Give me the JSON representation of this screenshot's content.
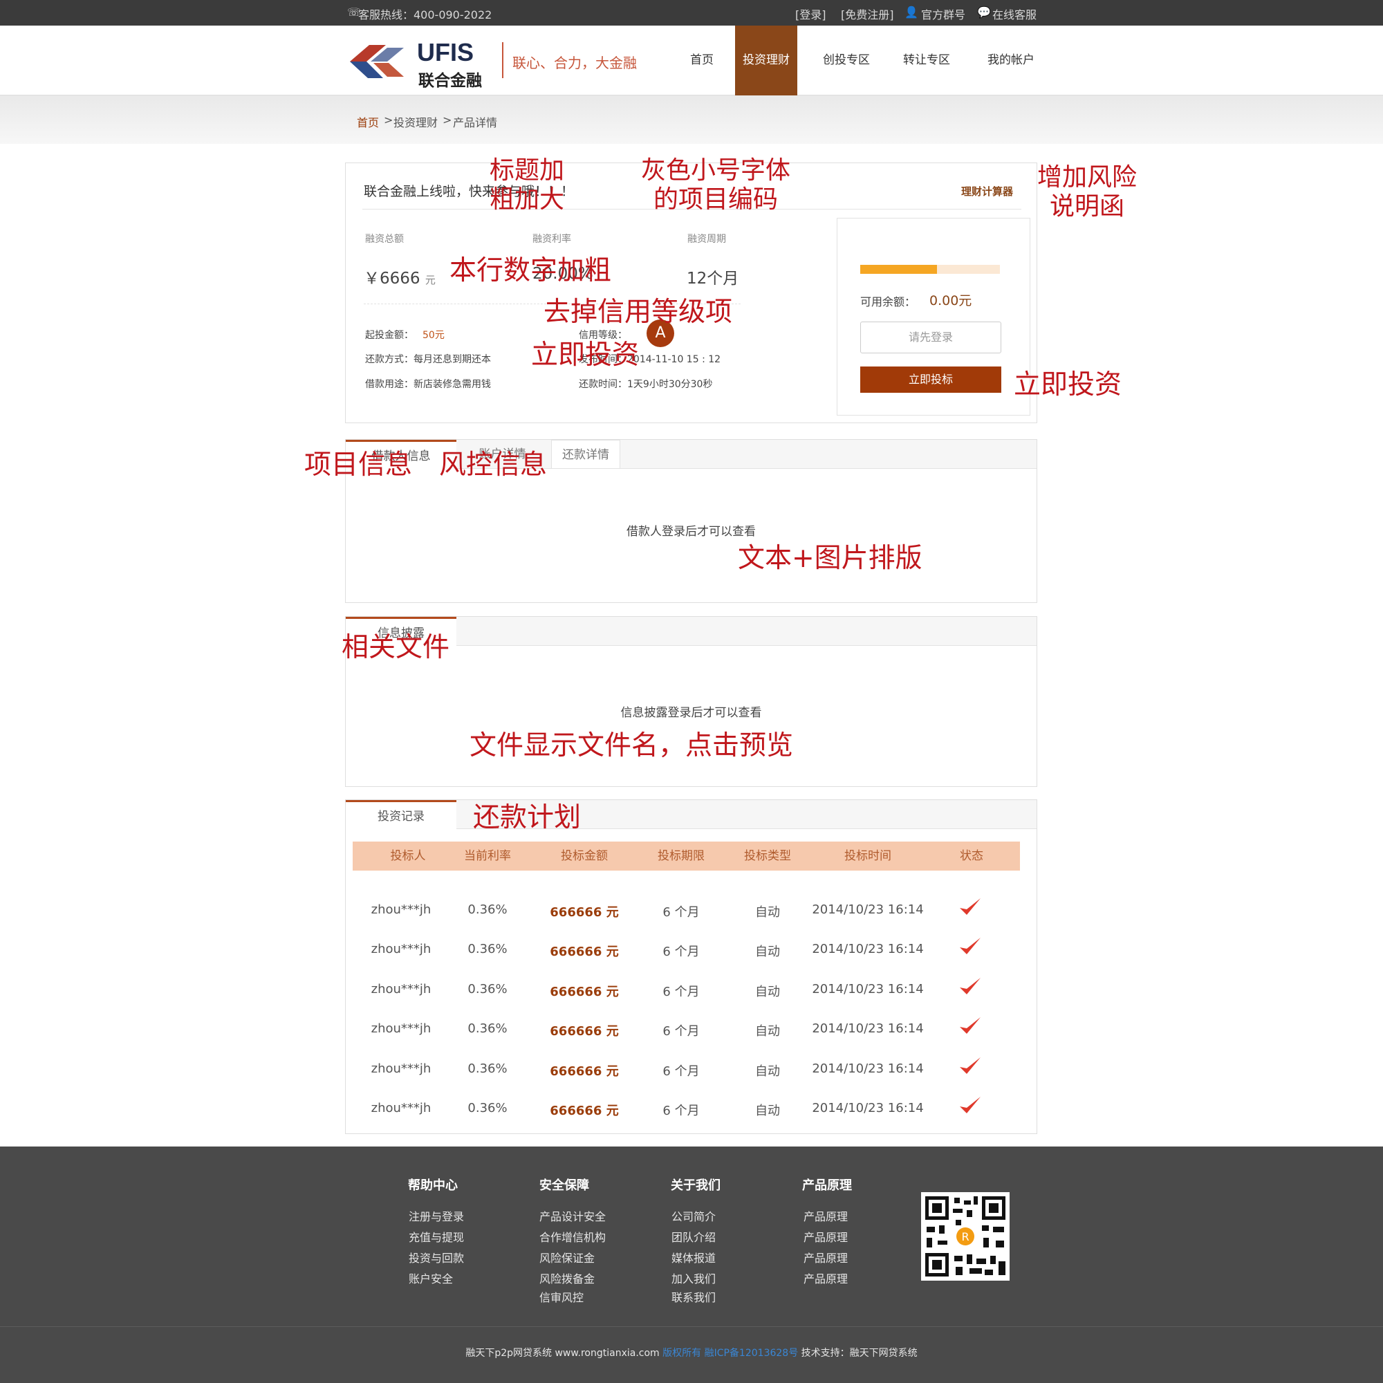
{
  "topbar": {
    "hotline": "客服热线：400-090-2022",
    "login": "[登录]",
    "register": "[免费注册]",
    "group": "官方群号",
    "service": "在线客服"
  },
  "brand": {
    "logo_en": "UFIS",
    "logo_cn": "联合金融",
    "slogan": "联心、合力，大金融"
  },
  "nav": [
    "首页",
    "投资理财",
    "创投专区",
    "转让专区",
    "我的帐户"
  ],
  "breadcrumb": {
    "home": "首页",
    "sep1": ">",
    "level2": "投资理财",
    "sep2": ">",
    "current": "产品详情"
  },
  "product": {
    "title": "联合金融上线啦，快来参与哦！！！",
    "calculator": "理财计算器",
    "total_label": "融资总额",
    "total_currency": "￥",
    "total_value": "6666",
    "total_unit": "元",
    "rate_label": "融资利率",
    "rate_value": "20.00%",
    "period_label": "融资周期",
    "period_value": "12个月",
    "min_label": "起投金额：",
    "min_value": "50元",
    "credit_label": "信用等级：",
    "credit_grade": "A",
    "repay_label": "还款方式：每月还息到期还本",
    "publish_label": "发布时间：2014-11-10 15 : 12",
    "usage_label": "借款用途：新店装修急需用钱",
    "remain_label": "还款时间：1天9小时30分30秒"
  },
  "invest_box": {
    "progress": 0.55,
    "balance_label": "可用余额：",
    "balance_value": "0.00元",
    "login_button": "请先登录",
    "invest_button": "立即投标"
  },
  "tabs1": [
    "借款人信息",
    "账户详情",
    "还款详情"
  ],
  "tabs1_message": "借款人登录后才可以查看",
  "tabs2": [
    "信息披露"
  ],
  "tabs2_message": "信息披露登录后才可以查看",
  "tabs3": [
    "投资记录"
  ],
  "records": {
    "headers": [
      "投标人",
      "当前利率",
      "投标金额",
      "投标期限",
      "投标类型",
      "投标时间",
      "状态"
    ],
    "rows": [
      [
        "zhou***jh",
        "0.36%",
        "666666 元",
        "6 个月",
        "自动",
        "2014/10/23  16:14"
      ],
      [
        "zhou***jh",
        "0.36%",
        "666666 元",
        "6 个月",
        "自动",
        "2014/10/23  16:14"
      ],
      [
        "zhou***jh",
        "0.36%",
        "666666 元",
        "6 个月",
        "自动",
        "2014/10/23  16:14"
      ],
      [
        "zhou***jh",
        "0.36%",
        "666666 元",
        "6 个月",
        "自动",
        "2014/10/23  16:14"
      ],
      [
        "zhou***jh",
        "0.36%",
        "666666 元",
        "6 个月",
        "自动",
        "2014/10/23  16:14"
      ],
      [
        "zhou***jh",
        "0.36%",
        "666666 元",
        "6 个月",
        "自动",
        "2014/10/23  16:14"
      ]
    ]
  },
  "annotations": {
    "title_bold": "标题加\n粗加大",
    "code_gray": "灰色小号字体\n的项目编码",
    "risk_letter": "增加风险\n说明函",
    "bold_numbers": "本行数字加粗",
    "remove_credit": "去掉信用等级项",
    "invest_now_mid": "立即投资",
    "invest_now_right": "立即投资",
    "project_info": "项目信息",
    "risk_info": "风控信息",
    "text_image": "文本+图片排版",
    "related_files": "相关文件",
    "file_preview": "文件显示文件名，点击预览",
    "repay_plan": "还款计划"
  },
  "footer": {
    "columns": [
      {
        "title": "帮助中心",
        "links": [
          "注册与登录",
          "充值与提现",
          "投资与回款",
          "账户安全"
        ]
      },
      {
        "title": "安全保障",
        "links": [
          "产品设计安全",
          "合作增信机构",
          "风险保证金",
          "风险拨备金",
          "信审风控"
        ]
      },
      {
        "title": "关于我们",
        "links": [
          "公司简介",
          "团队介绍",
          "媒体报道",
          "加入我们",
          "联系我们"
        ]
      },
      {
        "title": "产品原理",
        "links": [
          "产品原理",
          "产品原理",
          "产品原理",
          "产品原理"
        ]
      }
    ],
    "copyright_a": "融天下p2p网贷系统 www.rongtianxia.com",
    "copyright_b": "版权所有 融ICP备12013628号",
    "copyright_c": "技术支持：融天下网贷系统"
  },
  "colors": {
    "brand": "#8a4719",
    "accent": "#9b3d0b",
    "annotation": "#c0171c",
    "progress": "#f5a623"
  }
}
